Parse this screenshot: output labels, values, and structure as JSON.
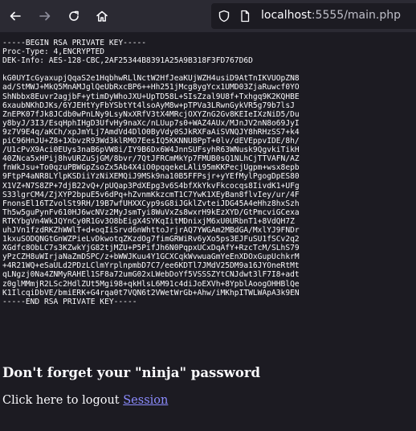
{
  "browser": {
    "url_host": "localhost",
    "url_rest": ":5555/main.php",
    "back_icon": "arrow-left-icon",
    "forward_icon": "arrow-right-icon",
    "reload_icon": "reload-icon",
    "home_icon": "home-icon",
    "shield_icon": "shield-icon",
    "page_icon": "page-icon",
    "colors": {
      "toolbar_bg": "#2b2a33",
      "page_bg": "#1c1b22",
      "text": "#fbfbfe",
      "link": "#8c8cff"
    }
  },
  "key": {
    "header_lines": [
      "-----BEGIN RSA PRIVATE KEY-----",
      "Proc-Type: 4,ENCRYPTED",
      "DEK-Info: AES-128-CBC,2AF25344B8391A25A9B318F3FD767D6D"
    ],
    "body_lines": [
      "kG0UYIcGyaxupjQqaS2e1HqbhwRLlNctW2HfJeaKUjWZH4usiD9AtTnIKVUOpZN8",
      "ad/StMWJ+MkQ5MnAMJglQeUbRxcBP6++Hh251jMcg8ygYcx1UMD03ZjaRuwcf0YO",
      "ShNbbx8Euvr2agjbF+ytimDyWhoJXU+UpTD58L+SIsZzal9U8f+Txhgq9K2KQHBE",
      "6xaubNKhDJKs/6YJEHtYyFbYSbtYt4lsoAyM8w+pTPVa3LRwnGykVR5g79b7lsJ",
      "ZnEPK07fJk8JCdb0wPnLNy9LsyNxXRfV3tX4MRcjOXYZnG2Gv8KEIeIXzNiD5/Du",
      "y8byJ/3I3/EsqHphIHgD3UfvHy9naXc/nLUup7s0+WAZ4AUx/MJnJV2nN8o69JyI",
      "9z7V9E4q/aKCh/xpJmYLj7AmdVd4DlO0ByVdy0SJkRXFaAiSVNQJY8hRHzSS7+k4",
      "piC96HnJU+Z8+1XbvzR93Wd3klRMO7EesIQ5KKNNU8PpT+0lv/dEVEppvIDE/8h/",
      "/U1cPvX9Aci0EUys3naB6pVW8i/IY9B6Dx6W4JnnSUFsyhR63WNusk9QgvkiTikH",
      "40ZNca5xHPij8hvURZuSjGM/8bvr/7QtJFRCmMkYp7FMUB0sQ1NLhCjTTVAFN/AZ",
      "fnWkJsu+To0qzuPBWGpZsoZx5Ab4X4iO0pqqekeLAli95mKKPecjUgpm+wsx8epb",
      "9FtpP4aNR8LYlpKSDiiYzNiXEMQiJ9MSk9na10B5FFPsjr+yYEfMylPgogDpES80",
      "X1VZ+N7S8ZP+7djB22vQ+/pUQap3PdXEpg3v6S4bfXkYkvFkcocqs8IivdK1+UFg",
      "S33lgrCM4/ZjXYP2bpuE5v6dPq+hZvnmKkzcmT1C7YwK1XEyBan8flvIey/ur/4F",
      "FnonsEl16TZvolSt9RH/19B7wfUHXXCyp9sG8iJGklZvteiJDG45A4eHhz8hxSzh",
      "Th5w5guPynFv610HJ6wcNVz2MyJsmTyi8WuVxZs8wxrH9kEzXYD/GtPmcviGCexa",
      "RTKYbgVn4WkJQYnCy0R1Gv3O8bEigX4SYKqIitMDnixjM6xU0URbnT1+8VdQH7Z",
      "uhJVn1fzdRKZhWWlT+d+oqIiSrvd6nWhttoJrjrAQ7YWGAm2MBdGA/MxlYJ9FNDr",
      "1kxuSODQNGtGnWZPieLvDkwotqZKzdOg7fimGRWiRv6yXo5ps3EJFuSU1fSCv2q2",
      "XGdfc8ObLC7s3KZwkYjG82tjMZU+P5PifJh6N0PqpxUCxDqAfY+RzcTcM/SLhS79",
      "yPzCZH8uWIrjaNaZmDSPC/z+bWWJKuu4Y1GCXCqkWvwuaGmYeEnXDOxGupUchkrM",
      "+4R21WQ+eSaULd2PDzLClmYrplnpmbD7C7/ee6KDTl7JMdV25DM9a16JYOneRtMt",
      "qLNgzj0Na4ZNMyRAHEl1SF8a72umG02xLWebDoYf5VSSSZYtCNJdwt3lF7I8+adt",
      "z0glMMmjR2LSc2HdlZUt5Mgi98+qkHlsL6M91c4diJoEXVh+8YpblAoogOHHBlQe",
      "K1IlcqiDbVE/bmiERK+G4rqa0t7VQN6t2VWetWrGb+Ahw/iMKhpITWLWApA3k9EN"
    ],
    "footer_line": "-----END RSA PRIVATE KEY-----"
  },
  "message": {
    "heading": "Don't forget your \"ninja\" password",
    "logout_prefix": "Click here to logout ",
    "logout_link": "Session"
  }
}
